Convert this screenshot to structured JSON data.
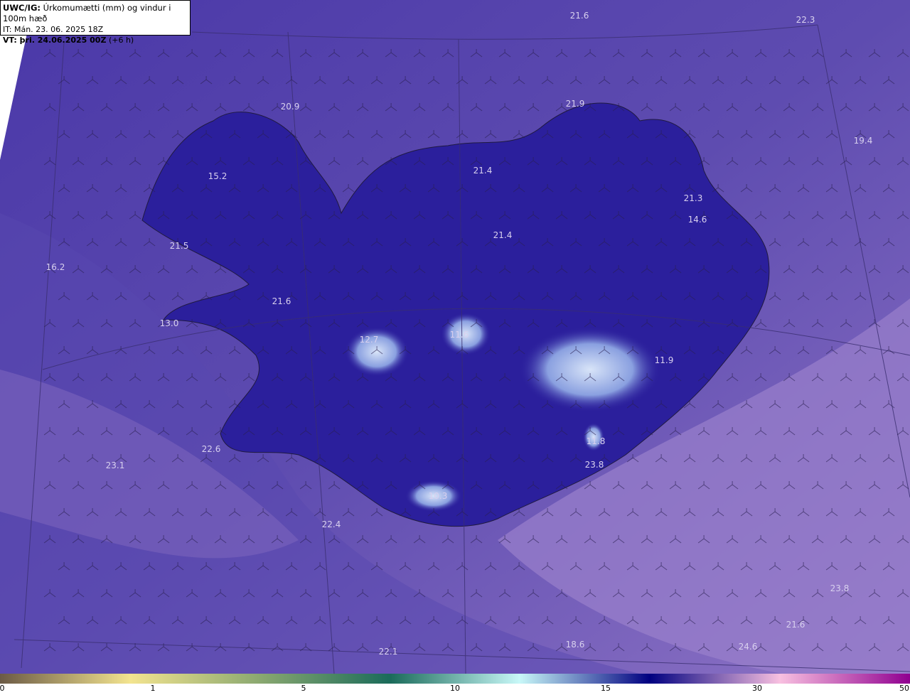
{
  "header": {
    "model_label": "UWC/IG:",
    "title": "Úrkomumætti (mm) og vindur i 100m hæð",
    "issue_time": "IT: Mán. 23. 06. 2025 18Z",
    "valid_label": "VT: þri. 24.06.2025 00Z",
    "lead_time": "(+6 h)"
  },
  "map_values": [
    "21.6",
    "22.3",
    "20.9",
    "21.9",
    "19.4",
    "15.2",
    "21.4",
    "21.3",
    "14.6",
    "21.5",
    "21.4",
    "16.2",
    "21.6",
    "13.0",
    "12.7",
    "11.6",
    "11.9",
    "11.8",
    "22.6",
    "23.8",
    "23.1",
    "10.3",
    "22.4",
    "23.8",
    "21.6",
    "22.1",
    "18.6",
    "24.6"
  ],
  "colorbar": {
    "ticks": [
      "0",
      "1",
      "5",
      "10",
      "15",
      "30",
      "50"
    ],
    "colors": [
      "#6b5a45",
      "#f3e48f",
      "#8aa870",
      "#1a6b5a",
      "#c8f8f8",
      "#000080",
      "#f8c0e0",
      "#900090"
    ]
  },
  "colors": {
    "ocean": "#5a48ac",
    "land": "#2b1f9c",
    "high_band": "#8c72c4"
  }
}
